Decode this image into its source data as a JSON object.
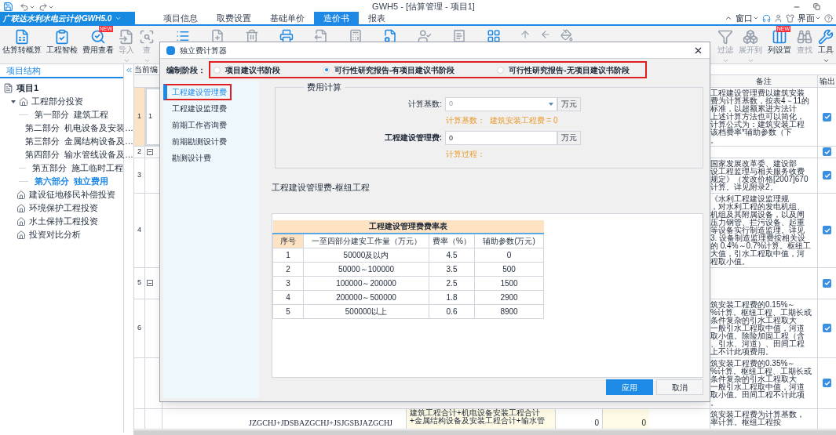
{
  "window": {
    "title": "GWH5 - [估算管理 - 项目1]"
  },
  "menu": {
    "product": "广联达水利水电云计价GWH5.0",
    "tabs": [
      {
        "label": "项目信息",
        "selected": false
      },
      {
        "label": "取费设置",
        "selected": false
      },
      {
        "label": "基础单价",
        "selected": false
      },
      {
        "label": "造价书",
        "selected": true
      },
      {
        "label": "报表",
        "selected": false
      }
    ],
    "right": [
      {
        "label": "窗口"
      },
      {
        "label": "界面"
      }
    ]
  },
  "toolbar": {
    "left": [
      {
        "label": "估算转概算",
        "disabled": false,
        "caret": false
      },
      {
        "label": "工程智检",
        "disabled": false,
        "caret": false
      },
      {
        "label": "费用查看",
        "disabled": false,
        "caret": false,
        "badge": "NEW"
      },
      {
        "label": "导入",
        "disabled": true,
        "caret": true
      },
      {
        "label": "查",
        "disabled": true,
        "caret": true
      }
    ],
    "right": [
      {
        "label": "过滤",
        "disabled": true,
        "caret": true
      },
      {
        "label": "展开到",
        "disabled": true,
        "caret": true
      },
      {
        "label": "列设置",
        "disabled": false,
        "caret": false,
        "badge": "NEW"
      },
      {
        "label": "查找",
        "disabled": true,
        "caret": false
      },
      {
        "label": "工具",
        "disabled": false,
        "caret": true
      }
    ]
  },
  "sidebar": {
    "tab": "项目结构",
    "tree": [
      {
        "label": "项目1",
        "selected": false,
        "children": [
          {
            "label": "工程部分投资",
            "selected": false,
            "expanded": true,
            "children": [
              {
                "label": "第一部分  建筑工程",
                "selected": false
              },
              {
                "label": "第二部分  机电设备及安装…",
                "selected": false
              },
              {
                "label": "第三部分  金属结构设备及…",
                "selected": false
              },
              {
                "label": "第四部分  输水管线设备及…",
                "selected": false
              },
              {
                "label": "第五部分  施工临时工程",
                "selected": false
              },
              {
                "label": "第六部分  独立费用",
                "selected": true
              }
            ]
          },
          {
            "label": "建设征地移民补偿投资",
            "selected": false,
            "expanded": false
          },
          {
            "label": "环境保护工程投资",
            "selected": false,
            "expanded": false
          },
          {
            "label": "水土保持工程投资",
            "selected": false,
            "expanded": false
          },
          {
            "label": "投资对比分析",
            "selected": false,
            "expanded": false
          }
        ]
      }
    ]
  },
  "grid": {
    "caption": "当前编",
    "columns": [
      "备注",
      "输出"
    ],
    "rows": [
      {
        "number": "1",
        "code": "1",
        "kind": "item",
        "selected": true,
        "output": true,
        "remark": [
          "工程建设管理费以建筑安装",
          "费为计算基数，按表4－11的",
          "标准，以超额累进方法计",
          "上述计算方法也可以简化，",
          "计算公式为：建筑安装工程",
          "该档费率*辅助参数（下",
          "。"
        ]
      },
      {
        "number": "2",
        "kind": "group",
        "selected": false,
        "output": true,
        "remark": []
      },
      {
        "number": "3",
        "kind": "item",
        "selected": false,
        "output": true,
        "remark": [
          "国家发展改革委、建设部",
          "设工程监理与相关服务收费",
          "规定》（发改价格[2007]670",
          "计算。详见附录2。"
        ]
      },
      {
        "number": "4",
        "kind": "item",
        "selected": false,
        "output": true,
        "remark": [
          "《水利工程建设监理规",
          "，对水利工程的发电机组、",
          "机组及其附属设备，以及闸",
          "压力钢管、拦污设备、起重",
          "等设备实行制造监理。详见",
          "3. 设备制造监理费按相关设",
          "的 0.4%～0.7%计算。枢纽工",
          "大值，引水工程取中值，河",
          "程取小值。"
        ]
      },
      {
        "number": "5",
        "kind": "group",
        "selected": false,
        "output": true,
        "remark": []
      },
      {
        "number": "6",
        "kind": "item",
        "selected": false,
        "output": true,
        "remark": [
          "筑安装工程费的0.15%～",
          "%计算。枢纽工程、工期长或",
          "条件复杂的引水工程取大",
          "一般引水工程取中值，河道",
          "取小值。除险加固工程（含",
          "、引水、河道）、田间工程",
          "上不计此项费用。"
        ]
      },
      {
        "kind": "item",
        "selected": false,
        "output": true,
        "remark": [
          "筑安装工程费的0.35%～",
          "%计算。枢纽工程、工期长或",
          "条件复杂的引水工程取大",
          "一般引水工程取中值，河道",
          "取小值。田间工程不计此项",
          "。"
        ]
      },
      {
        "kind": "item",
        "selected": false,
        "remark": [
          "筑安装工程费为计算基数，",
          "率计算。枢纽工程按"
        ],
        "formula": "JZGCHJ+JDSBAZGCHJ+JSJGSBJAZGCHJ",
        "expression": [
          "建筑工程合计+机电设备安装工程合计",
          "+金属结构设备及安装工程合计+输水管"
        ],
        "values": [
          "0",
          "0"
        ]
      }
    ]
  },
  "dialog": {
    "title": "独立费计算器",
    "phase_label": "编制阶段：",
    "phases": [
      {
        "label": "项目建议书阶段",
        "selected": false
      },
      {
        "label": "可行性研究报告-有项目建议书阶段",
        "selected": true
      },
      {
        "label": "可行性研究报告-无项目建议书阶段",
        "selected": false
      }
    ],
    "fee_items": [
      {
        "label": "工程建设管理费",
        "selected": true
      },
      {
        "label": "工程建设监理费",
        "selected": false
      },
      {
        "label": "前期工作咨询费",
        "selected": false
      },
      {
        "label": "前期勘测设计费",
        "selected": false
      },
      {
        "label": "勘测设计费",
        "selected": false
      }
    ],
    "calc": {
      "legend": "费用计算",
      "base_label": "计算基数:",
      "base_value": "0",
      "base_unit": "万元",
      "base_note": "计算基数：  建筑安装工程费 = 0",
      "fee_label": "工程建设管理费:",
      "fee_value": "0",
      "fee_unit": "万元",
      "process_note": "计算过程："
    },
    "section_title": "工程建设管理费-枢纽工程",
    "rate_table": {
      "title": "工程建设管理费费率表",
      "columns": [
        "序号",
        "一至四部分建安工作量（万元）",
        "费率（%）",
        "辅助参数(万元)"
      ],
      "rows": [
        [
          "1",
          "50000及以内",
          "4.5",
          "0"
        ],
        [
          "2",
          "50000～100000",
          "3.5",
          "500"
        ],
        [
          "3",
          "100000～200000",
          "2.5",
          "1500"
        ],
        [
          "4",
          "200000～500000",
          "1.8",
          "2900"
        ],
        [
          "5",
          "500000以上",
          "0.6",
          "8900"
        ]
      ]
    },
    "buttons": [
      {
        "label": "应用",
        "kind": "primary"
      },
      {
        "label": "取消",
        "kind": "default"
      }
    ]
  }
}
